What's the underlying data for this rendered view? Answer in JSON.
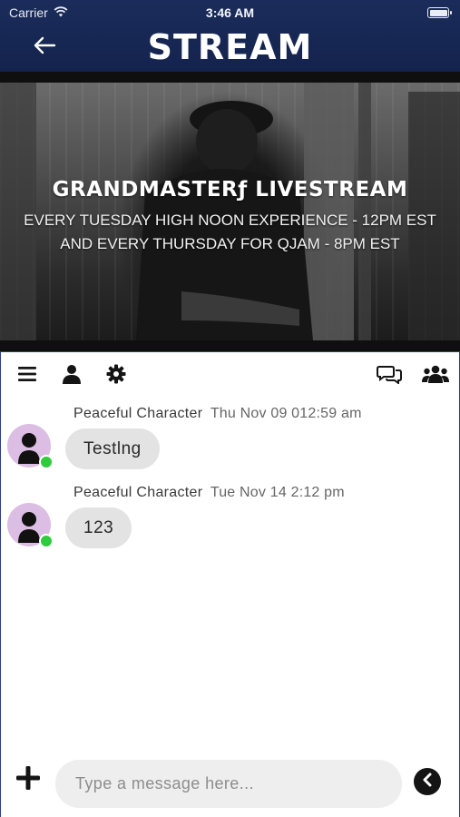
{
  "status_bar": {
    "carrier": "Carrier",
    "time": "3:46 AM"
  },
  "header": {
    "brand": "STREAM",
    "back_icon": "arrow-left-icon"
  },
  "hero": {
    "title": "GRANDMASTERƒ LIVESTREAM",
    "line1": "EVERY TUESDAY HIGH NOON EXPERIENCE - 12PM EST",
    "line2": "AND EVERY THURSDAY FOR QJAM - 8PM EST"
  },
  "toolbar": {
    "left_icons": [
      "menu-icon",
      "user-icon",
      "gear-icon"
    ],
    "right_icons": [
      "chat-bubbles-icon",
      "users-group-icon"
    ]
  },
  "messages": [
    {
      "author": "Peaceful Character",
      "time": "Thu Nov 09 012:59 am",
      "text": "Testlng",
      "online": true
    },
    {
      "author": "Peaceful Character",
      "time": "Tue Nov 14 2:12 pm",
      "text": "123",
      "online": true
    }
  ],
  "composer": {
    "placeholder": "Type a message here...",
    "add_icon": "plus-icon",
    "send_icon": "chevron-left-circle-icon"
  },
  "colors": {
    "header_bg": "#1b2c5c",
    "panel_border": "#2c3f86",
    "avatar_bg": "#dcbde3",
    "online": "#2ccc3c",
    "bubble_bg": "#e3e3e3",
    "input_bg": "#eeeeee"
  }
}
